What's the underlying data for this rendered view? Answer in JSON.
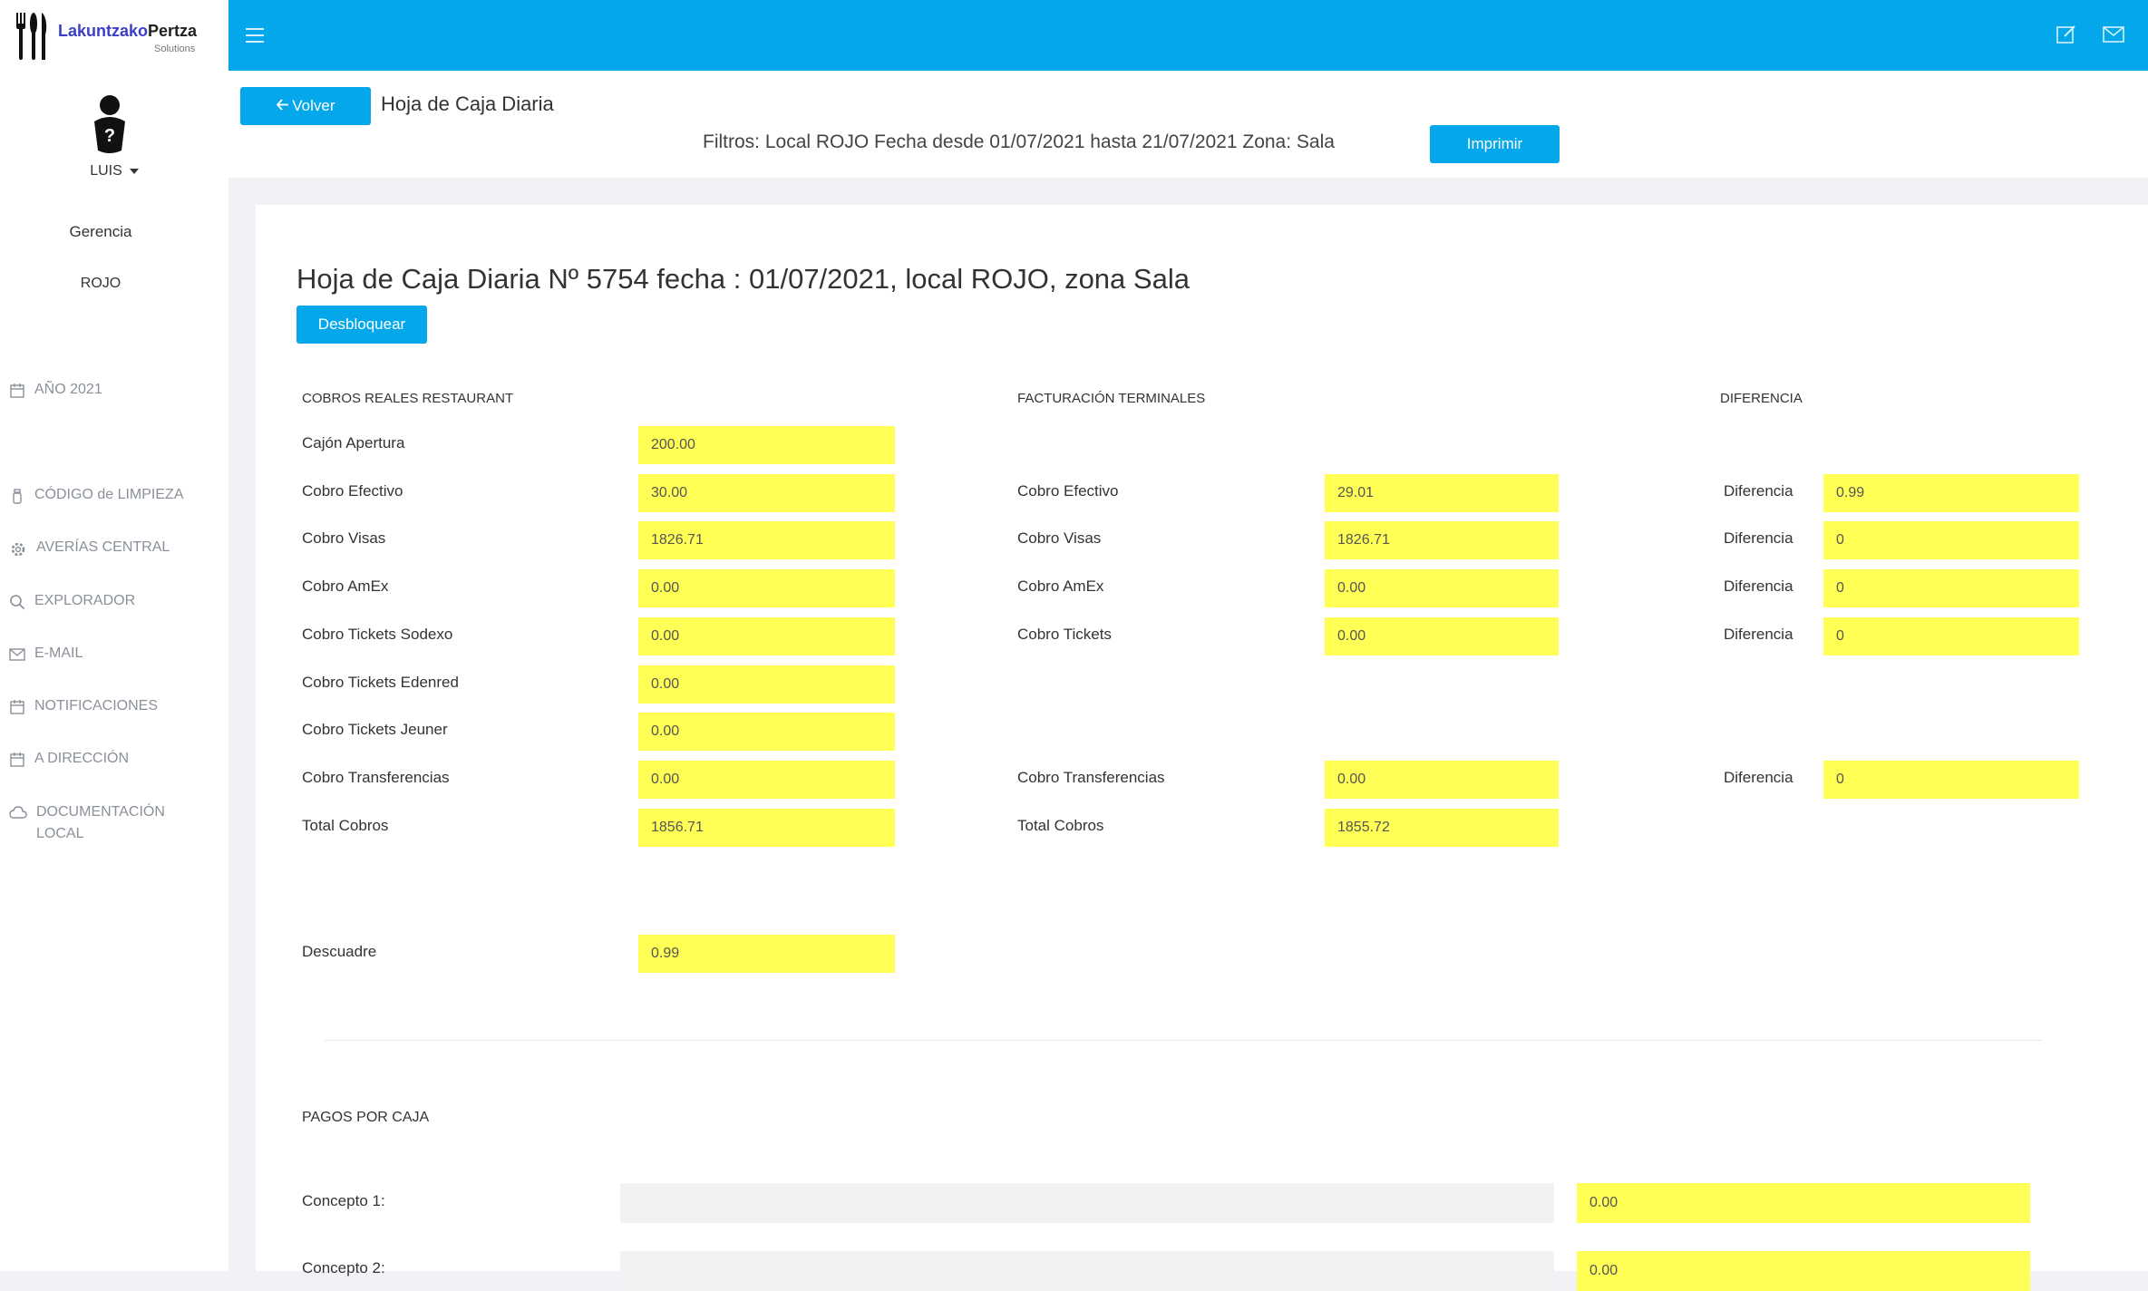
{
  "logo": {
    "brand_part1": "Lakuntzako",
    "brand_part2": "Pertza",
    "sub": "Solutions"
  },
  "user": {
    "name": "LUIS"
  },
  "sidebar": {
    "role": "Gerencia",
    "local": "ROJO",
    "items": [
      {
        "label": "AÑO 2021",
        "icon": "calendar-icon"
      },
      {
        "label": "CÓDIGO de LIMPIEZA",
        "icon": "bottle-icon"
      },
      {
        "label": "AVERÍAS CENTRAL",
        "icon": "gear-icon"
      },
      {
        "label": "EXPLORADOR",
        "icon": "search-icon"
      },
      {
        "label": "E-MAIL",
        "icon": "mail-icon"
      },
      {
        "label": "NOTIFICACIONES",
        "icon": "calendar-icon"
      },
      {
        "label": "A DIRECCIÓN",
        "icon": "calendar-icon"
      },
      {
        "label": "DOCUMENTACIÓN LOCAL",
        "icon": "cloud-icon"
      }
    ]
  },
  "header": {
    "back_label": "Volver",
    "title": "Hoja de Caja Diaria",
    "filters": "Filtros: Local ROJO Fecha desde 01/07/2021 hasta 21/07/2021 Zona: Sala",
    "print_label": "Imprimir"
  },
  "sheet": {
    "title": "Hoja de Caja Diaria Nº 5754 fecha : 01/07/2021, local ROJO, zona Sala",
    "unlock_label": "Desbloquear",
    "sections": {
      "cobros": "COBROS REALES RESTAURANT",
      "facturacion": "FACTURACIÓN TERMINALES",
      "diferencia": "DIFERENCIA"
    },
    "cobros": [
      {
        "label": "Cajón Apertura",
        "value": "200.00"
      },
      {
        "label": "Cobro Efectivo",
        "value": "30.00"
      },
      {
        "label": "Cobro Visas",
        "value": "1826.71"
      },
      {
        "label": "Cobro AmEx",
        "value": "0.00"
      },
      {
        "label": "Cobro Tickets Sodexo",
        "value": "0.00"
      },
      {
        "label": "Cobro Tickets Edenred",
        "value": "0.00"
      },
      {
        "label": "Cobro Tickets Jeuner",
        "value": "0.00"
      },
      {
        "label": "Cobro Transferencias",
        "value": "0.00"
      },
      {
        "label": "Total Cobros",
        "value": "1856.71"
      }
    ],
    "facturacion": [
      {
        "label": "Cobro Efectivo",
        "value": "29.01"
      },
      {
        "label": "Cobro Visas",
        "value": "1826.71"
      },
      {
        "label": "Cobro AmEx",
        "value": "0.00"
      },
      {
        "label": "Cobro Tickets",
        "value": "0.00"
      },
      {
        "label": "Cobro Transferencias",
        "value": "0.00"
      },
      {
        "label": "Total Cobros",
        "value": "1855.72"
      }
    ],
    "diferencias": [
      {
        "label": "Diferencia",
        "value": "0.99"
      },
      {
        "label": "Diferencia",
        "value": "0"
      },
      {
        "label": "Diferencia",
        "value": "0"
      },
      {
        "label": "Diferencia",
        "value": "0"
      },
      {
        "label": "Diferencia",
        "value": "0"
      }
    ],
    "descuadre": {
      "label": "Descuadre",
      "value": "0.99"
    },
    "pagos": {
      "title": "PAGOS POR CAJA",
      "rows": [
        {
          "label": "Concepto 1:",
          "concept": "",
          "value": "0.00"
        },
        {
          "label": "Concepto 2:",
          "concept": "",
          "value": "0.00"
        }
      ]
    }
  },
  "colors": {
    "accent": "#04a7ea",
    "highlight": "#ffff55"
  }
}
